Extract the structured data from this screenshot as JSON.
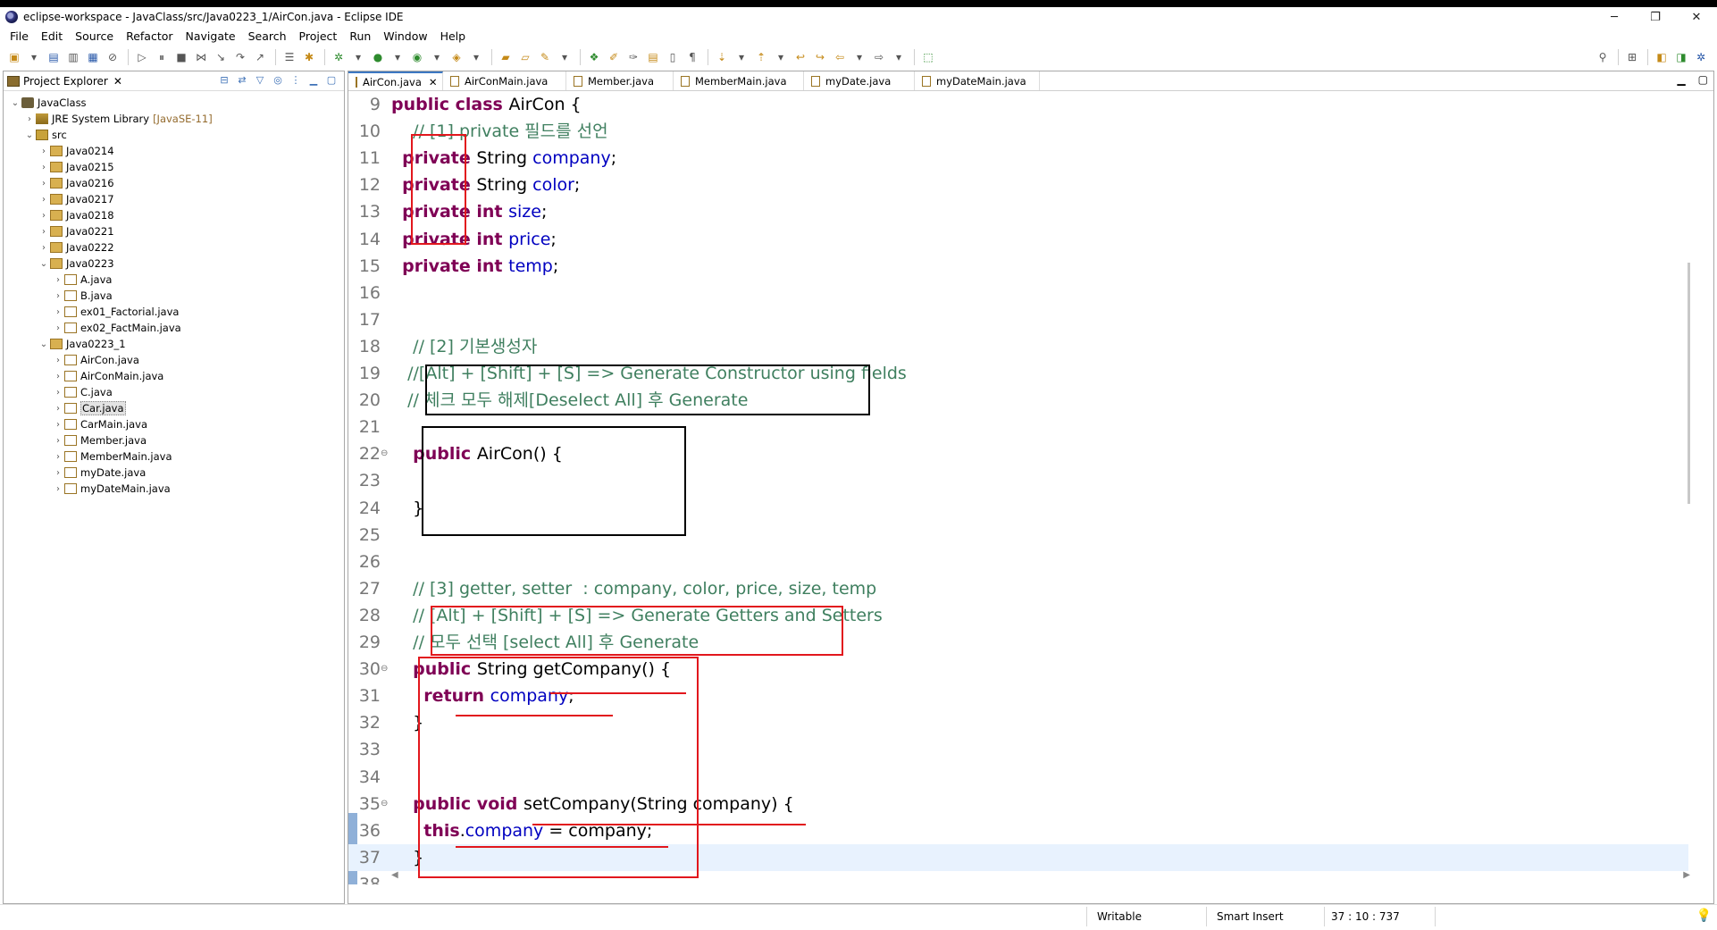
{
  "window": {
    "title": "eclipse-workspace - JavaClass/src/Java0223_1/AirCon.java - Eclipse IDE",
    "controls": [
      "─",
      "❐",
      "✕"
    ]
  },
  "menu": [
    "File",
    "Edit",
    "Source",
    "Refactor",
    "Navigate",
    "Search",
    "Project",
    "Run",
    "Window",
    "Help"
  ],
  "explorer": {
    "title": "Project Explorer",
    "tree": [
      {
        "level": 0,
        "chev": "⌄",
        "icon": "project",
        "label": "JavaClass"
      },
      {
        "level": 1,
        "chev": "›",
        "icon": "jre",
        "label": "JRE System Library",
        "extra": "[JavaSE-11]"
      },
      {
        "level": 1,
        "chev": "⌄",
        "icon": "src",
        "label": "src"
      },
      {
        "level": 2,
        "chev": "›",
        "icon": "pkg",
        "label": "Java0214"
      },
      {
        "level": 2,
        "chev": "›",
        "icon": "pkg",
        "label": "Java0215"
      },
      {
        "level": 2,
        "chev": "›",
        "icon": "pkg",
        "label": "Java0216"
      },
      {
        "level": 2,
        "chev": "›",
        "icon": "pkg",
        "label": "Java0217"
      },
      {
        "level": 2,
        "chev": "›",
        "icon": "pkg",
        "label": "Java0218"
      },
      {
        "level": 2,
        "chev": "›",
        "icon": "pkg",
        "label": "Java0221"
      },
      {
        "level": 2,
        "chev": "›",
        "icon": "pkg",
        "label": "Java0222"
      },
      {
        "level": 2,
        "chev": "⌄",
        "icon": "pkg",
        "label": "Java0223"
      },
      {
        "level": 3,
        "chev": "›",
        "icon": "java",
        "label": "A.java"
      },
      {
        "level": 3,
        "chev": "›",
        "icon": "java",
        "label": "B.java"
      },
      {
        "level": 3,
        "chev": "›",
        "icon": "java",
        "label": "ex01_Factorial.java"
      },
      {
        "level": 3,
        "chev": "›",
        "icon": "java",
        "label": "ex02_FactMain.java"
      },
      {
        "level": 2,
        "chev": "⌄",
        "icon": "pkg",
        "label": "Java0223_1"
      },
      {
        "level": 3,
        "chev": "›",
        "icon": "java",
        "label": "AirCon.java"
      },
      {
        "level": 3,
        "chev": "›",
        "icon": "java",
        "label": "AirConMain.java"
      },
      {
        "level": 3,
        "chev": "›",
        "icon": "java",
        "label": "C.java"
      },
      {
        "level": 3,
        "chev": "›",
        "icon": "java",
        "label": "Car.java",
        "selected": true
      },
      {
        "level": 3,
        "chev": "›",
        "icon": "java",
        "label": "CarMain.java"
      },
      {
        "level": 3,
        "chev": "›",
        "icon": "java",
        "label": "Member.java"
      },
      {
        "level": 3,
        "chev": "›",
        "icon": "java",
        "label": "MemberMain.java"
      },
      {
        "level": 3,
        "chev": "›",
        "icon": "java",
        "label": "myDate.java"
      },
      {
        "level": 3,
        "chev": "›",
        "icon": "java",
        "label": "myDateMain.java"
      }
    ]
  },
  "editor": {
    "tabs": [
      {
        "label": "AirCon.java",
        "active": true
      },
      {
        "label": "AirConMain.java"
      },
      {
        "label": "Member.java"
      },
      {
        "label": "MemberMain.java"
      },
      {
        "label": "myDate.java"
      },
      {
        "label": "myDateMain.java"
      }
    ],
    "lines": [
      {
        "n": "9",
        "segs": [
          [
            "kw",
            "public class "
          ],
          [
            "plain",
            "AirCon {"
          ]
        ]
      },
      {
        "n": "10",
        "segs": [
          [
            "plain",
            "    "
          ],
          [
            "cmt",
            "// [1] private 필드를 선언"
          ]
        ]
      },
      {
        "n": "11",
        "segs": [
          [
            "plain",
            "  "
          ],
          [
            "kw",
            "private "
          ],
          [
            "plain",
            "String "
          ],
          [
            "fld",
            "company"
          ],
          [
            "plain",
            ";"
          ]
        ]
      },
      {
        "n": "12",
        "segs": [
          [
            "plain",
            "  "
          ],
          [
            "kw",
            "private "
          ],
          [
            "plain",
            "String "
          ],
          [
            "fld",
            "color"
          ],
          [
            "plain",
            ";"
          ]
        ]
      },
      {
        "n": "13",
        "segs": [
          [
            "plain",
            "  "
          ],
          [
            "kw",
            "private "
          ],
          [
            "kw",
            "int "
          ],
          [
            "fld",
            "size"
          ],
          [
            "plain",
            ";"
          ]
        ]
      },
      {
        "n": "14",
        "segs": [
          [
            "plain",
            "  "
          ],
          [
            "kw",
            "private "
          ],
          [
            "kw",
            "int "
          ],
          [
            "fld",
            "price"
          ],
          [
            "plain",
            ";"
          ]
        ]
      },
      {
        "n": "15",
        "segs": [
          [
            "plain",
            "  "
          ],
          [
            "kw",
            "private "
          ],
          [
            "kw",
            "int "
          ],
          [
            "fld",
            "temp"
          ],
          [
            "plain",
            ";"
          ]
        ]
      },
      {
        "n": "16",
        "segs": []
      },
      {
        "n": "17",
        "segs": []
      },
      {
        "n": "18",
        "segs": [
          [
            "plain",
            "    "
          ],
          [
            "cmt",
            "// [2] 기본생성자"
          ]
        ]
      },
      {
        "n": "19",
        "segs": [
          [
            "plain",
            "   "
          ],
          [
            "cmt",
            "//[Alt] + [Shift] + [S] => Generate Constructor using fields"
          ]
        ]
      },
      {
        "n": "20",
        "segs": [
          [
            "plain",
            "   "
          ],
          [
            "cmt",
            "// 체크 모두 해제[Deselect All] 후 Generate"
          ]
        ]
      },
      {
        "n": "21",
        "segs": []
      },
      {
        "n": "22",
        "fold": "⊖",
        "segs": [
          [
            "plain",
            "    "
          ],
          [
            "kw",
            "public "
          ],
          [
            "plain",
            "AirCon() {"
          ]
        ]
      },
      {
        "n": "23",
        "segs": []
      },
      {
        "n": "24",
        "segs": [
          [
            "plain",
            "    }"
          ]
        ]
      },
      {
        "n": "25",
        "segs": []
      },
      {
        "n": "26",
        "segs": []
      },
      {
        "n": "27",
        "segs": [
          [
            "plain",
            "    "
          ],
          [
            "cmt",
            "// [3] getter, setter  : company, color, price, size, temp"
          ]
        ]
      },
      {
        "n": "28",
        "segs": [
          [
            "plain",
            "    "
          ],
          [
            "cmt",
            "// [Alt] + [Shift] + [S] => Generate Getters and Setters"
          ]
        ]
      },
      {
        "n": "29",
        "segs": [
          [
            "plain",
            "    "
          ],
          [
            "cmt",
            "// 모두 선택 [select All] 후 Generate"
          ]
        ]
      },
      {
        "n": "30",
        "fold": "⊖",
        "segs": [
          [
            "plain",
            "    "
          ],
          [
            "kw",
            "public "
          ],
          [
            "plain",
            "String getCompany() {"
          ]
        ]
      },
      {
        "n": "31",
        "segs": [
          [
            "plain",
            "      "
          ],
          [
            "kw",
            "return "
          ],
          [
            "fld",
            "company"
          ],
          [
            "plain",
            ";"
          ]
        ]
      },
      {
        "n": "32",
        "segs": [
          [
            "plain",
            "    }"
          ]
        ]
      },
      {
        "n": "33",
        "segs": []
      },
      {
        "n": "34",
        "segs": []
      },
      {
        "n": "35",
        "fold": "⊖",
        "segs": [
          [
            "plain",
            "    "
          ],
          [
            "kw",
            "public void "
          ],
          [
            "plain",
            "setCompany(String "
          ],
          [
            "plain",
            "company) {"
          ]
        ]
      },
      {
        "n": "36",
        "segs": [
          [
            "plain",
            "      "
          ],
          [
            "kw",
            "this"
          ],
          [
            "plain",
            "."
          ],
          [
            "fld",
            "company"
          ],
          [
            "plain",
            " = company;"
          ]
        ]
      },
      {
        "n": "37",
        "current": true,
        "segs": [
          [
            "plain",
            "    }"
          ]
        ]
      },
      {
        "n": "38",
        "segs": []
      }
    ]
  },
  "status": {
    "writable": "Writable",
    "insert_mode": "Smart Insert",
    "position": "37 : 10 : 737"
  }
}
